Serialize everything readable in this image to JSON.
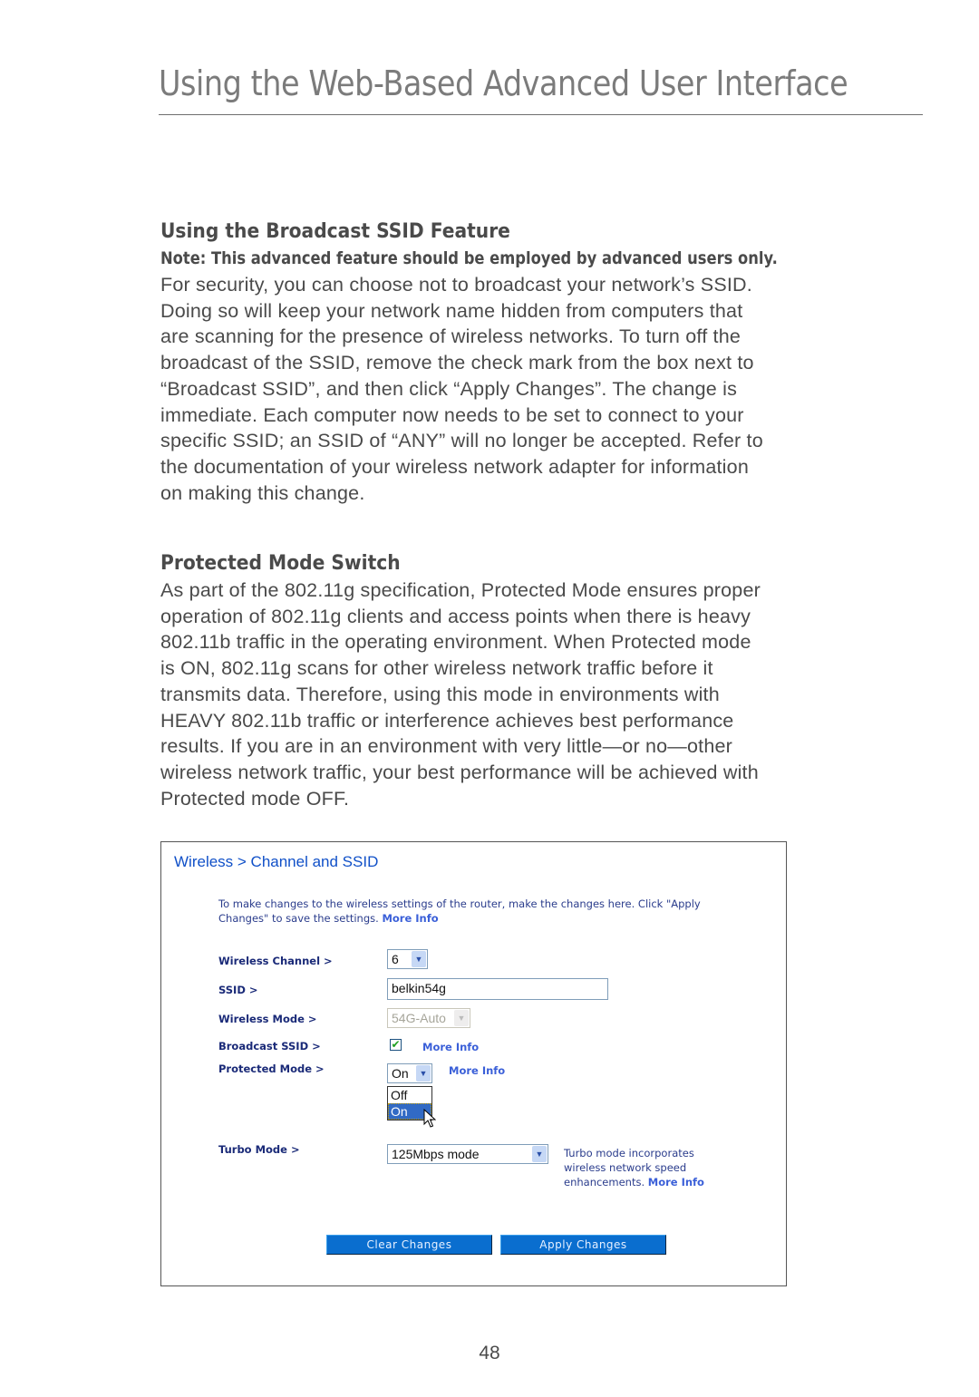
{
  "header": {
    "title": "Using the Web-Based Advanced User Interface"
  },
  "sections": [
    {
      "heading": "Using the Broadcast SSID Feature",
      "note": "Note: This advanced feature should be employed by advanced users only.",
      "lines": [
        "For security, you can choose not to broadcast your network’s SSID.",
        "Doing so will keep your network name hidden from computers that",
        "are scanning for the presence of wireless networks. To turn off the",
        "broadcast of the SSID, remove the check mark from the box next to",
        "“Broadcast SSID”, and then click “Apply Changes”. The change is",
        "immediate. Each computer now needs to be set to connect to your",
        "specific SSID; an SSID of “ANY” will no longer be accepted. Refer to",
        "the documentation of your wireless network adapter for information",
        "on making this change."
      ]
    },
    {
      "heading": "Protected Mode Switch",
      "lines": [
        "As part of the 802.11g specification, Protected Mode ensures proper",
        "operation of 802.11g clients and access points when there is heavy",
        "802.11b traffic in the operating environment. When Protected mode",
        "is ON, 802.11g scans for other wireless network traffic before it",
        "transmits data. Therefore, using this mode in environments with",
        "HEAVY 802.11b traffic or interference achieves best performance",
        "results. If you are in an environment with very little—or no—other",
        "wireless network traffic, your best performance will be achieved with",
        "Protected mode OFF."
      ]
    }
  ],
  "screenshot": {
    "title": "Wireless > Channel and SSID",
    "intro_line1": "To make changes to the wireless settings of the router, make the changes here. Click \"Apply",
    "intro_line2": "Changes\" to save the settings.",
    "more_info": "More Info",
    "fields": {
      "wireless_channel": {
        "label": "Wireless Channel >",
        "value": "6"
      },
      "ssid": {
        "label": "SSID >",
        "value": "belkin54g"
      },
      "wireless_mode": {
        "label": "Wireless Mode >",
        "value": "54G-Auto",
        "disabled": true
      },
      "broadcast_ssid": {
        "label": "Broadcast SSID >",
        "checked": true
      },
      "protected_mode": {
        "label": "Protected Mode >",
        "value": "On",
        "options": [
          "Off",
          "On"
        ],
        "highlighted": "On"
      },
      "turbo_mode": {
        "label": "Turbo Mode >",
        "value": "125Mbps mode",
        "desc_line1": "Turbo mode incorporates",
        "desc_line2": "wireless network speed",
        "desc_line3": "enhancements."
      }
    },
    "buttons": {
      "clear": "Clear Changes",
      "apply": "Apply Changes"
    },
    "icons": {
      "dropdown_arrow": "▼",
      "check": "✔"
    }
  },
  "footer": {
    "page_number": "48"
  }
}
